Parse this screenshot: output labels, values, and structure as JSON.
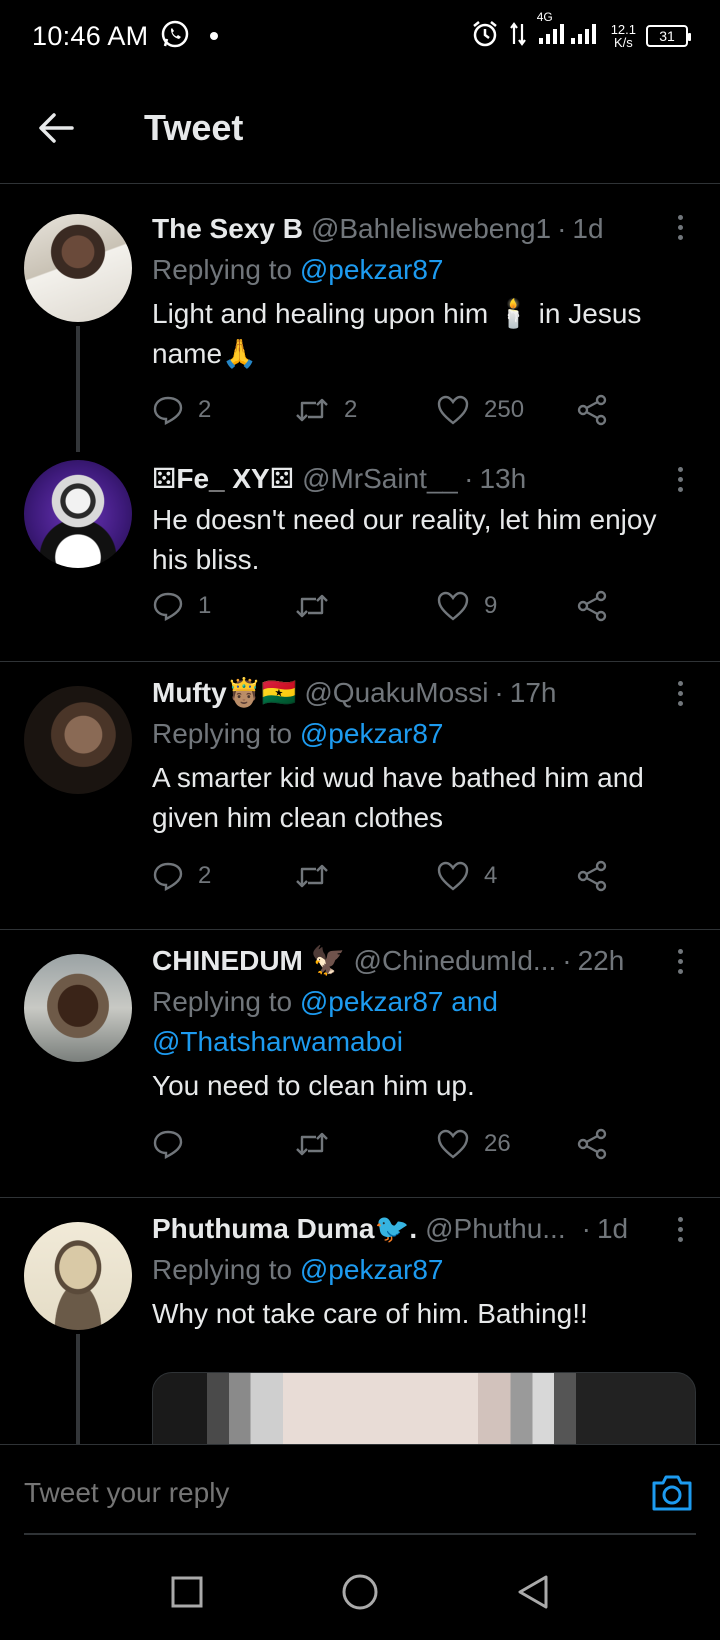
{
  "status_bar": {
    "time": "10:46 AM",
    "network": "4G",
    "speed_value": "12.1",
    "speed_unit": "K/s",
    "battery": "31"
  },
  "header": {
    "title": "Tweet"
  },
  "tweets": [
    {
      "name": "The Sexy B",
      "handle": "@Bahleliswebeng1",
      "time": "1d",
      "replying_prefix": "Replying to",
      "replying_to": "@pekzar87",
      "text": "Light and healing upon him 🕯️ in Jesus name🙏",
      "replies": "2",
      "retweets": "2",
      "likes": "250"
    },
    {
      "name": "⚄Fe_ XY⚄",
      "handle": "@MrSaint__",
      "time": "13h",
      "text": "He doesn't need our reality, let him enjoy his bliss.",
      "replies": "1",
      "retweets": "",
      "likes": "9"
    },
    {
      "name": "Mufty🤴🏽🇬🇭",
      "handle": "@QuakuMossi",
      "time": "17h",
      "replying_prefix": "Replying to",
      "replying_to": "@pekzar87",
      "text": "A smarter kid wud have bathed him and given him clean clothes",
      "replies": "2",
      "retweets": "",
      "likes": "4"
    },
    {
      "name": "CHINEDUM 🦅",
      "handle": "@ChinedumId...",
      "time": "22h",
      "replying_prefix": "Replying to",
      "replying_to": "@pekzar87 and @Thatsharwamaboi",
      "text": "You need to clean him up.",
      "replies": "",
      "retweets": "",
      "likes": "26"
    },
    {
      "name": "Phuthuma Duma🐦.",
      "handle": "@Phuthu...",
      "time": "1d",
      "replying_prefix": "Replying to",
      "replying_to": "@pekzar87",
      "text": "Why not take care of him. Bathing!!"
    }
  ],
  "reply_bar": {
    "placeholder": "Tweet your reply"
  },
  "colors": {
    "background": "#000000",
    "text": "#e7e9ea",
    "secondary": "#71767b",
    "accent": "#1d9bf0",
    "divider": "#2f3336"
  },
  "icons": [
    "whatsapp-icon",
    "alarm-icon",
    "data-arrows-icon",
    "signal-icon",
    "back-arrow-icon",
    "more-icon",
    "reply-icon",
    "retweet-icon",
    "like-icon",
    "share-icon",
    "camera-icon",
    "recents-icon",
    "home-icon",
    "back-icon"
  ]
}
